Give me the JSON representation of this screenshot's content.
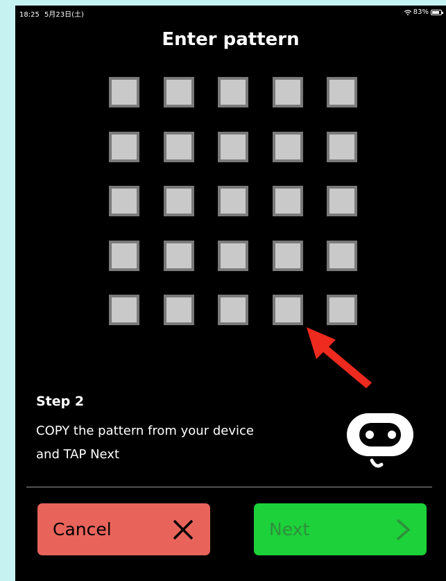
{
  "status_bar": {
    "time": "18:25",
    "date": "5月23日(土)",
    "battery": "83%",
    "battery_level": 0.83
  },
  "title": "Enter pattern",
  "pattern": {
    "rows": 5,
    "cols": 5,
    "cells": [
      [
        0,
        0,
        0,
        0,
        0
      ],
      [
        0,
        0,
        0,
        0,
        0
      ],
      [
        0,
        0,
        0,
        0,
        0
      ],
      [
        0,
        0,
        0,
        0,
        0
      ],
      [
        0,
        0,
        0,
        0,
        0
      ]
    ],
    "cell_color": "#c9c9c9",
    "cell_border_color": "#7a7a7a"
  },
  "step": {
    "title": "Step 2",
    "text": "COPY the pattern from your device and TAP Next"
  },
  "buttons": {
    "cancel_label": "Cancel",
    "next_label": "Next",
    "cancel_color": "#e8645b",
    "next_color": "#1cd13a"
  },
  "icons": {
    "cancel": "close-icon",
    "next": "chevron-right-icon",
    "device": "microbit-device-icon",
    "annotation": "red-arrow"
  }
}
